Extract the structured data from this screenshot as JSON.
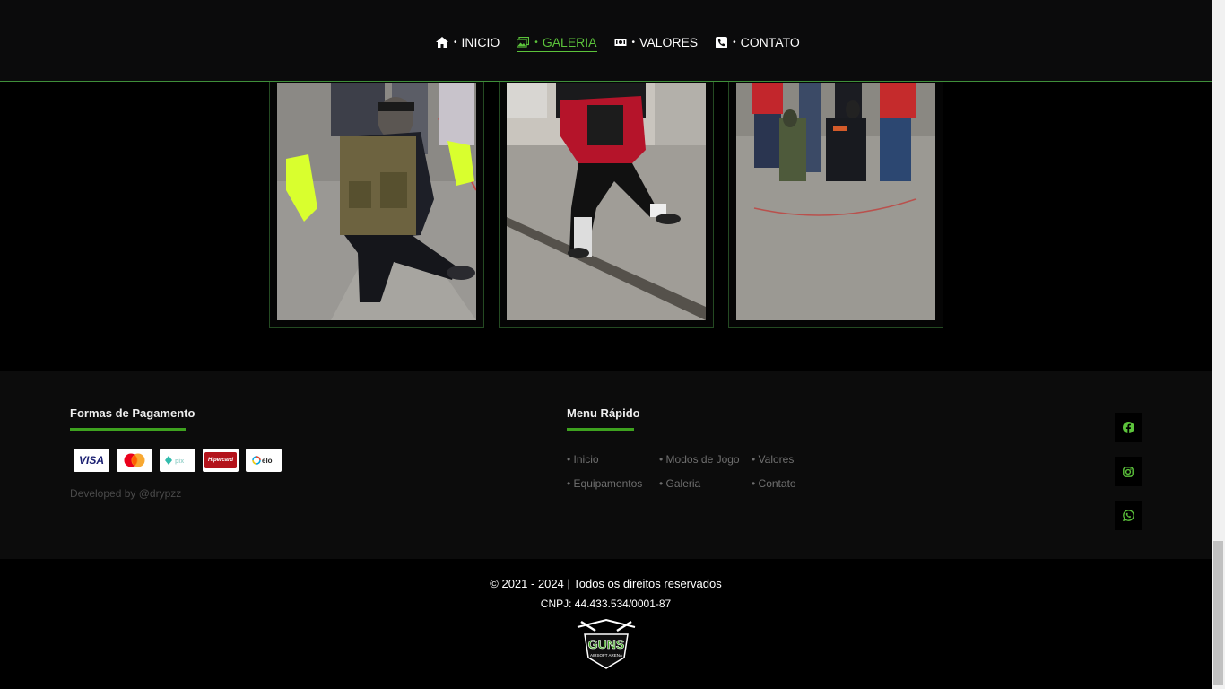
{
  "nav": {
    "items": [
      {
        "label": "INICIO",
        "icon": "home-icon",
        "active": false
      },
      {
        "label": "GALERIA",
        "icon": "gallery-icon",
        "active": true
      },
      {
        "label": "VALORES",
        "icon": "money-icon",
        "active": false
      },
      {
        "label": "CONTATO",
        "icon": "phone-icon",
        "active": false
      }
    ],
    "accent": "#5cc33b"
  },
  "footer": {
    "payments_title": "Formas de Pagamento",
    "payment_methods": [
      "VISA",
      "Mastercard",
      "Pix",
      "Hipercard",
      "elo"
    ],
    "developer": "Developed by @drypzz",
    "menu_title": "Menu Rápido",
    "menu_links": [
      "Inicio",
      "Modos de Jogo",
      "Valores",
      "Equipamentos",
      "Galeria",
      "Contato"
    ],
    "social": [
      "facebook-icon",
      "instagram-icon",
      "whatsapp-icon"
    ]
  },
  "bottom": {
    "copyright": "© 2021 - 2024 | Todos os direitos reservados",
    "cnpj": "CNPJ: 44.433.534/0001-87",
    "logo_text": "GUNS",
    "logo_sub": "AIRSOFT ARENA"
  }
}
